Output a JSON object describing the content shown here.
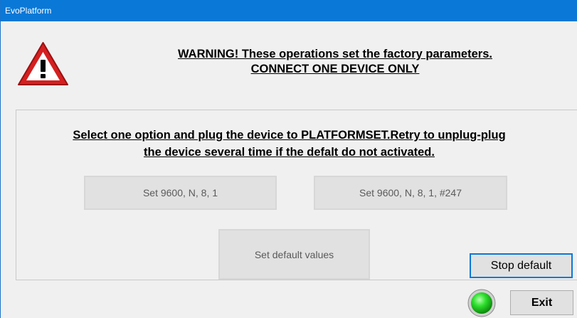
{
  "window": {
    "title": "EvoPlatform"
  },
  "warning": {
    "line1": "WARNING! These operations set the factory parameters.",
    "line2": "CONNECT ONE DEVICE ONLY",
    "icon": "warning-triangle-icon"
  },
  "instructions": {
    "line1": "Select one option and plug the device to PLATFORMSET.Retry to unplug-plug",
    "line2": "the device several time if the defalt do not activated."
  },
  "buttons": {
    "set_9600": "Set 9600, N, 8, 1",
    "set_9600_247": "Set 9600, N, 8, 1, #247",
    "set_default": "Set default values",
    "stop_default": "Stop default",
    "exit": "Exit"
  },
  "status_led": {
    "color": "#22cc22",
    "icon": "status-led-icon"
  },
  "colors": {
    "titlebar": "#0a78d7",
    "accent_border": "#0a78d7"
  }
}
